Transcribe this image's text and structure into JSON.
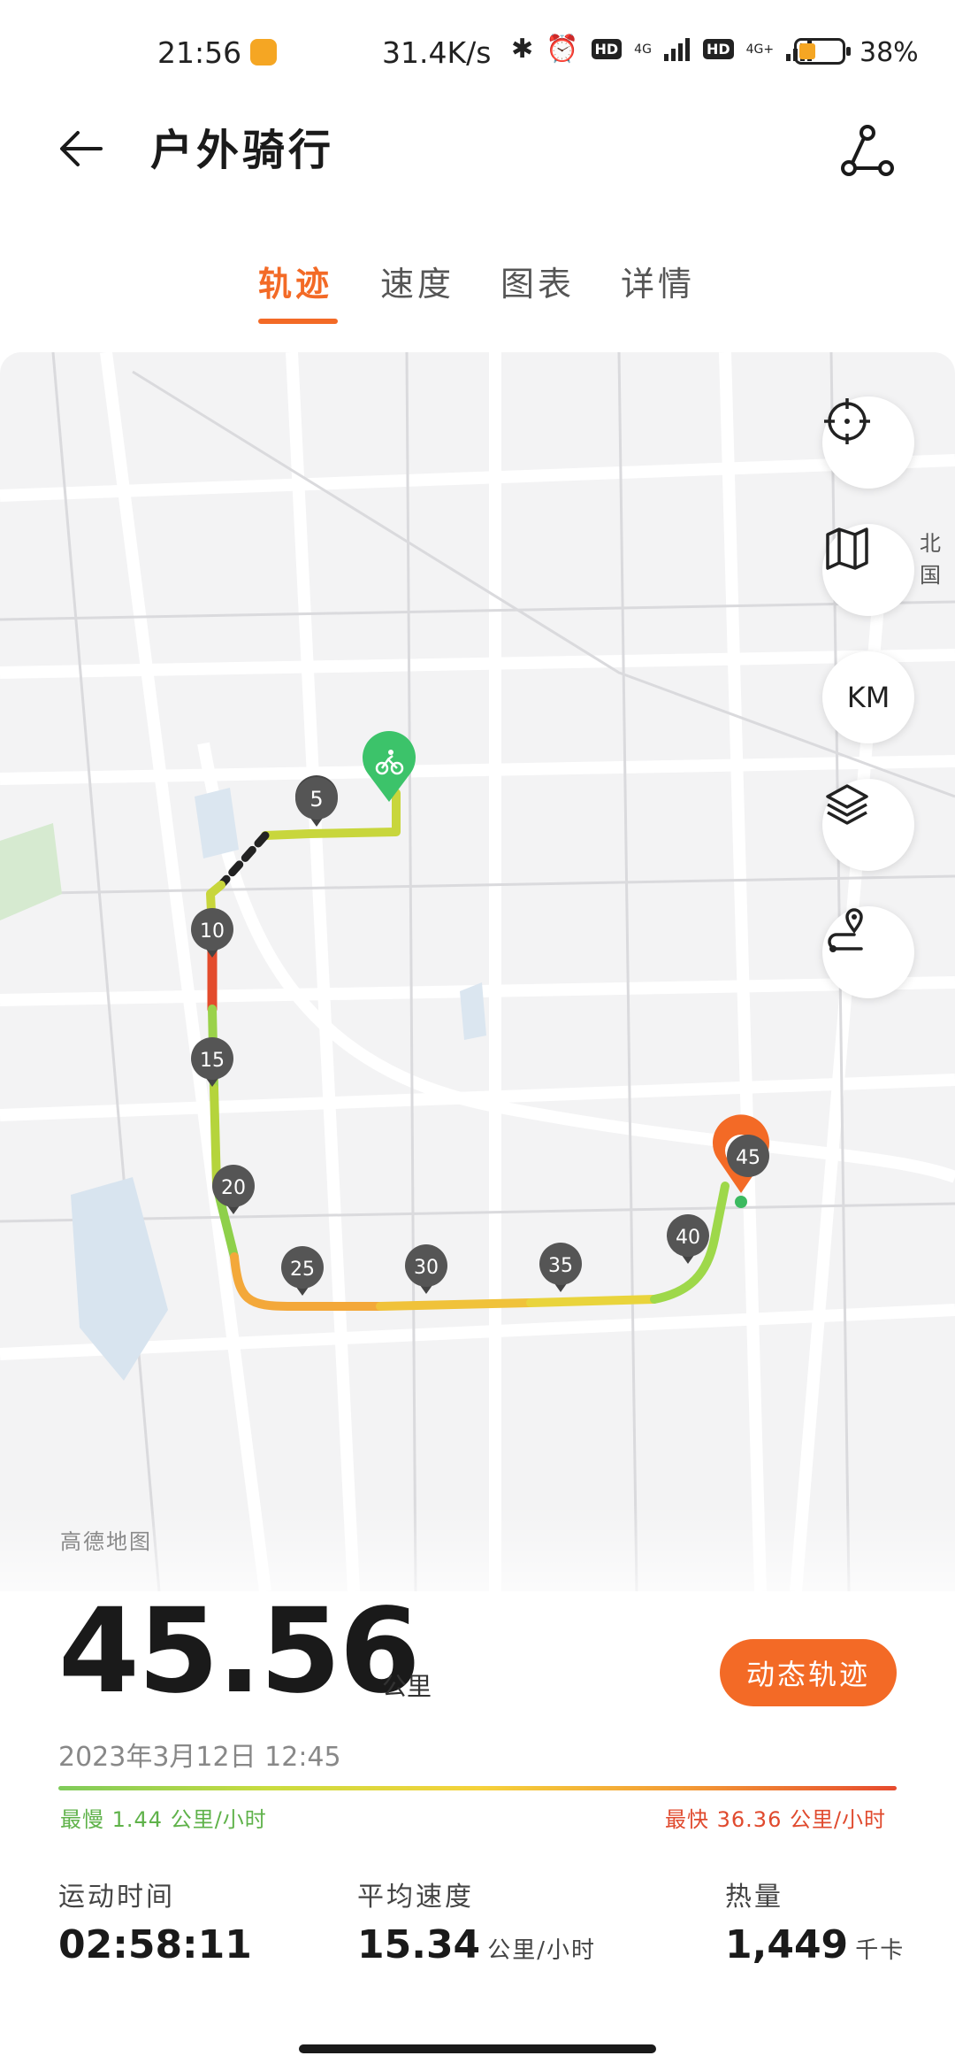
{
  "status_bar": {
    "time": "21:56",
    "net_speed": "31.4K/s",
    "hd1": "HD",
    "hd2": "HD",
    "sig1": "4G",
    "sig2": "4G+",
    "battery_pct": "38%",
    "battery_level": 0.38
  },
  "header": {
    "title": "户外骑行"
  },
  "tabs": [
    {
      "label": "轨迹",
      "active": true
    },
    {
      "label": "速度",
      "active": false
    },
    {
      "label": "图表",
      "active": false
    },
    {
      "label": "详情",
      "active": false
    }
  ],
  "map": {
    "provider_credit": "高德地图",
    "km_label": "KM",
    "edge_text_1": "北",
    "edge_text_2": "国",
    "km_markers": [
      "5",
      "10",
      "15",
      "20",
      "25",
      "30",
      "35",
      "40",
      "45"
    ]
  },
  "summary": {
    "distance": "45.56",
    "distance_unit": "公里",
    "dynamic_track_button": "动态轨迹",
    "datetime": "2023年3月12日  12:45",
    "slowest": "最慢 1.44 公里/小时",
    "fastest": "最快 36.36 公里/小时"
  },
  "stats": [
    {
      "label": "运动时间",
      "value": "02:58:11",
      "unit": ""
    },
    {
      "label": "平均速度",
      "value": "15.34",
      "unit": "公里/小时"
    },
    {
      "label": "热量",
      "value": "1,449",
      "unit": "千卡"
    }
  ],
  "colors": {
    "accent": "#f36a26",
    "start_pin": "#3cc36a",
    "slow": "#5fb24a",
    "fast": "#e04a2e"
  }
}
